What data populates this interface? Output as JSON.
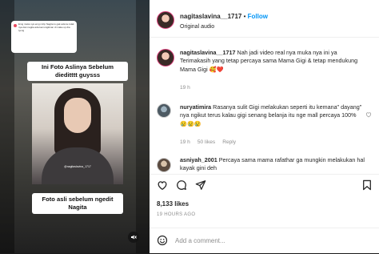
{
  "video": {
    "comment_text": "Emg muka nya emg mirip Nagita tu gak ada ke tolak nya dan nagita ada kemungkinan di make up dia iyeng",
    "caption_top": "Ini Foto Aslinya Sebelum dieditttt guysss",
    "watermark": "@nagitaslavina_1717",
    "caption_bottom": "Foto asli sebelum ngedit Nagita"
  },
  "post": {
    "username": "nagitaslavina__1717",
    "separator": " • ",
    "follow_label": "Follow",
    "audio": "Original audio"
  },
  "comments": [
    {
      "username": "nagitaslavina__1717",
      "text": "Nah jadi video real nya muka nya ini ya Terimakasih yang tetap percaya sama Mama Gigi & tetap mendukung Mama Gigi 🥰❤️",
      "time": "19 h"
    },
    {
      "username": "nuryatimira",
      "text": "Rasanya sulit Gigi melakukan seperti itu kemana\" dayang\" nya ngikut terus kalau gigi senang belanja itu nge mall percaya 100% 😢😢😢",
      "time": "19 h",
      "likes": "50 likes",
      "reply": "Reply"
    },
    {
      "username": "asniyah_2001",
      "text": "Percaya sama mama rafathar ga mungkin melakukan hal kayak gini deh"
    }
  ],
  "footer": {
    "likes": "8,133 likes",
    "ago": "19 HOURS AGO",
    "add_comment_placeholder": "Add a comment..."
  },
  "icons": {
    "like": "heart-icon",
    "comment": "comment-icon",
    "share": "share-icon",
    "save": "bookmark-icon",
    "emoji": "smiley-icon",
    "mute": "speaker-muted-icon"
  },
  "colors": {
    "follow": "#0095f6",
    "meta": "#8e8e8e",
    "avatar_ring": "#d93f7a"
  }
}
